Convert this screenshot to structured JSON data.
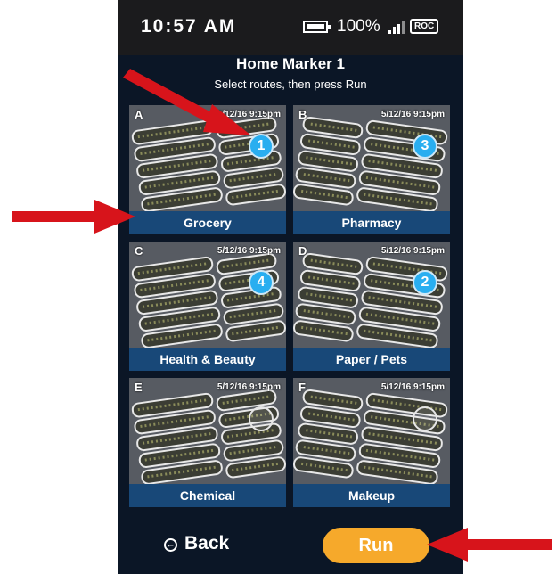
{
  "status_bar": {
    "time": "10:57 AM",
    "battery_percent": "100%",
    "battery_level": 1.0,
    "carrier": "ROC"
  },
  "header": {
    "title": "Home Marker 1",
    "subtitle": "Select routes, then press Run"
  },
  "routes": [
    {
      "letter": "A",
      "timestamp": "5/12/16 9:15pm",
      "label": "Grocery",
      "order": "1",
      "selected": true
    },
    {
      "letter": "B",
      "timestamp": "5/12/16 9:15pm",
      "label": "Pharmacy",
      "order": "3",
      "selected": true
    },
    {
      "letter": "C",
      "timestamp": "5/12/16 9:15pm",
      "label": "Health & Beauty",
      "order": "4",
      "selected": true
    },
    {
      "letter": "D",
      "timestamp": "5/12/16 9:15pm",
      "label": "Paper / Pets",
      "order": "2",
      "selected": true
    },
    {
      "letter": "E",
      "timestamp": "5/12/16 9:15pm",
      "label": "Chemical",
      "order": "",
      "selected": false
    },
    {
      "letter": "F",
      "timestamp": "5/12/16 9:15pm",
      "label": "Makeup",
      "order": "",
      "selected": false
    }
  ],
  "footer": {
    "back_label": "Back",
    "run_label": "Run"
  },
  "colors": {
    "background": "#0b1626",
    "label_bar": "#184878",
    "badge": "#29aef0",
    "run_button": "#f6a92b",
    "annotation_arrow": "#d7141b"
  }
}
